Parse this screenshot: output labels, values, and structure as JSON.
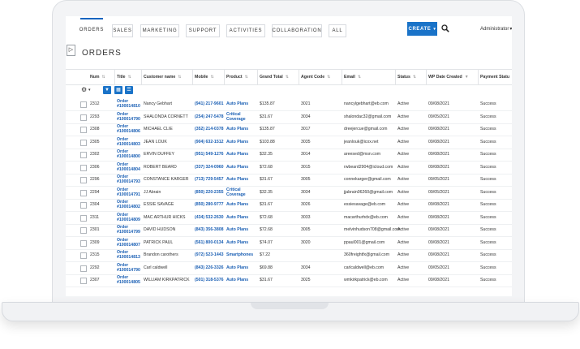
{
  "nav": {
    "tabs": [
      "ORDERS",
      "SALES",
      "MARKETING",
      "SUPPORT",
      "ACTIVITIES",
      "COLLABORATION",
      "ALL"
    ],
    "active": "ORDERS",
    "create_label": "CREATE",
    "user": "Administrator"
  },
  "page": {
    "title": "ORDERS"
  },
  "table": {
    "columns": [
      "Num",
      "Title",
      "Customer name",
      "Mobile",
      "Product",
      "Grand Total",
      "Agent Code",
      "Email",
      "Status",
      "WP Date Created",
      "Payment Statu"
    ],
    "rows": [
      {
        "num": "2312",
        "title1": "Order",
        "title2": "#100014810",
        "customer": "Nancy Gebhart",
        "mobile": "(941) 217-9601",
        "product1": "Auto Plans",
        "product2": "",
        "total": "$135.87",
        "agent": "3021",
        "email": "nancylgebhart@eb.com",
        "status": "Active",
        "date": "09/08/2021",
        "payment": "Success"
      },
      {
        "num": "2293",
        "title1": "Order",
        "title2": "#100014790",
        "customer": "SHALONDA CORNETT",
        "mobile": "(254) 247-5478",
        "product1": "Critical",
        "product2": "Coverage",
        "total": "$31.67",
        "agent": "3034",
        "email": "shalondac32@gmail.com",
        "status": "Active",
        "date": "09/05/2021",
        "payment": "Success"
      },
      {
        "num": "2308",
        "title1": "Order",
        "title2": "#100014806",
        "customer": "MICHAEL CLIE",
        "mobile": "(352) 214-0378",
        "product1": "Auto Plans",
        "product2": "",
        "total": "$135.87",
        "agent": "3017",
        "email": "dreejercue@gmail.com",
        "status": "Active",
        "date": "09/08/2021",
        "payment": "Success"
      },
      {
        "num": "2305",
        "title1": "Order",
        "title2": "#100014803",
        "customer": "JEAN LOUK",
        "mobile": "(904) 632-1512",
        "product1": "Auto Plans",
        "product2": "",
        "total": "$103.88",
        "agent": "3035",
        "email": "jeanlouk@icox.net",
        "status": "Active",
        "date": "09/08/2021",
        "payment": "Success"
      },
      {
        "num": "2302",
        "title1": "Order",
        "title2": "#100014800",
        "customer": "ERVIN DUFFEY",
        "mobile": "(951) 549-1276",
        "product1": "Auto Plans",
        "product2": "",
        "total": "$32.35",
        "agent": "3014",
        "email": "areesed@msn.com",
        "status": "Active",
        "date": "09/08/2021",
        "payment": "Success"
      },
      {
        "num": "2306",
        "title1": "Order",
        "title2": "#100014804",
        "customer": "ROBERT BEARD",
        "mobile": "(337) 324-0960",
        "product1": "Auto Plans",
        "product2": "",
        "total": "$72.68",
        "agent": "3015",
        "email": "rwbeard2904@icloud.com",
        "status": "Active",
        "date": "09/08/2021",
        "payment": "Success"
      },
      {
        "num": "2296",
        "title1": "Order",
        "title2": "#100014793",
        "customer": "CONSTANCE KARGER",
        "mobile": "(713) 729-5457",
        "product1": "Auto Plans",
        "product2": "",
        "total": "$31.67",
        "agent": "3005",
        "email": "connekarger@gmail.com",
        "status": "Active",
        "date": "09/05/2021",
        "payment": "Success"
      },
      {
        "num": "2294",
        "title1": "Order",
        "title2": "#100014791",
        "customer": "JJ Abrain",
        "mobile": "(850) 220-2355",
        "product1": "Critical",
        "product2": "Coverage",
        "total": "$32.35",
        "agent": "3034",
        "email": "jjabrain06260@gmail.com",
        "status": "Active",
        "date": "09/05/2021",
        "payment": "Success"
      },
      {
        "num": "2304",
        "title1": "Order",
        "title2": "#100014802",
        "customer": "ESSIE SAVAGE",
        "mobile": "(850) 280-9777",
        "product1": "Auto Plans",
        "product2": "",
        "total": "$31.67",
        "agent": "3026",
        "email": "essiesavage@eb.com",
        "status": "Active",
        "date": "09/08/2021",
        "payment": "Success"
      },
      {
        "num": "2311",
        "title1": "Order",
        "title2": "#100014809",
        "customer": "MAC ARTHUR HICKS",
        "mobile": "(434) 532-2630",
        "product1": "Auto Plans",
        "product2": "",
        "total": "$72.68",
        "agent": "3033",
        "email": "macarthurhdx@eb.com",
        "status": "Active",
        "date": "09/08/2021",
        "payment": "Success"
      },
      {
        "num": "2301",
        "title1": "Order",
        "title2": "#100014799",
        "customer": "DAVID HUDSON",
        "mobile": "(843) 356-3808",
        "product1": "Auto Plans",
        "product2": "",
        "total": "$72.68",
        "agent": "3005",
        "email": "melvinhudson708@gmail.com",
        "status": "Active",
        "date": "09/08/2021",
        "payment": "Success"
      },
      {
        "num": "2309",
        "title1": "Order",
        "title2": "#100014807",
        "customer": "PATRICK PAUL",
        "mobile": "(561) 800-0134",
        "product1": "Auto Plans",
        "product2": "",
        "total": "$74.07",
        "agent": "3020",
        "email": "ppaul001@gmail.com",
        "status": "Active",
        "date": "09/08/2021",
        "payment": "Success"
      },
      {
        "num": "2315",
        "title1": "Order",
        "title2": "#100014813",
        "customer": "Brandon carothers",
        "mobile": "(972) 523-1443",
        "product1": "Smartphones",
        "product2": "",
        "total": "$7.22",
        "agent": "",
        "email": "360freightfx@gmail.com",
        "status": "Active",
        "date": "09/08/2021",
        "payment": "Success"
      },
      {
        "num": "2292",
        "title1": "Order",
        "title2": "#100014790",
        "customer": "Carl caldwell",
        "mobile": "(843) 226-3326",
        "product1": "Auto Plans",
        "product2": "",
        "total": "$69.88",
        "agent": "3034",
        "email": "carlcaldwell@eb.com",
        "status": "Active",
        "date": "09/05/2021",
        "payment": "Success"
      },
      {
        "num": "2307",
        "title1": "Order",
        "title2": "#100014805",
        "customer": "WILLIAM KIRKPATRICK",
        "mobile": "(501) 318-5376",
        "product1": "Auto Plans",
        "product2": "",
        "total": "$31.67",
        "agent": "3025",
        "email": "wmkirkpatrick@eb.com",
        "status": "Active",
        "date": "09/08/2021",
        "payment": "Success"
      }
    ]
  }
}
